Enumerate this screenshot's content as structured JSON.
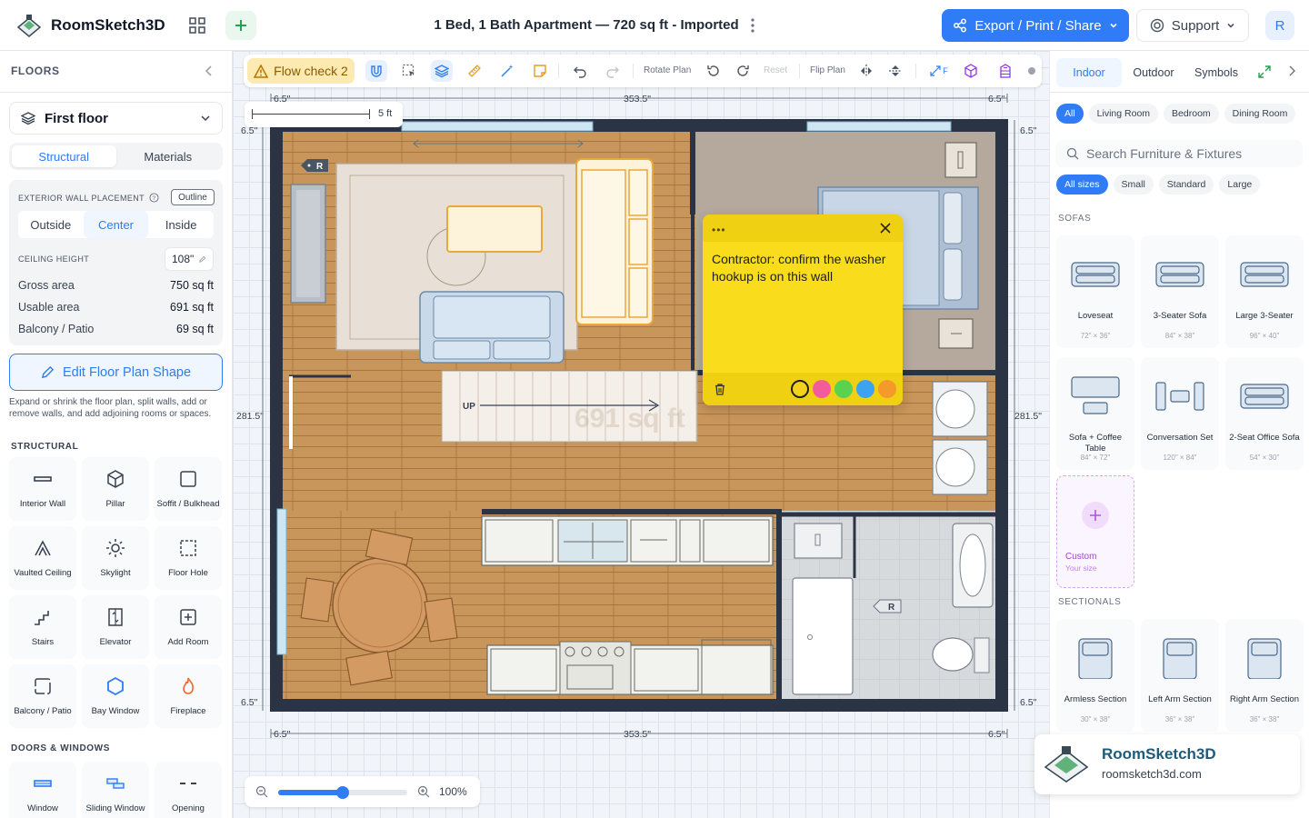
{
  "app": {
    "name": "RoomSketch3D",
    "document_title": "1 Bed, 1 Bath Apartment — 720 sq ft - Imported"
  },
  "header": {
    "export_label": "Export / Print / Share",
    "support_label": "Support",
    "avatar_initial": "R"
  },
  "sidebar": {
    "title": "FLOORS",
    "floor_selected": "First floor",
    "tabs": [
      "Structural",
      "Materials"
    ],
    "exterior_wall_placement": {
      "label": "EXTERIOR WALL PLACEMENT",
      "outline_label": "Outline",
      "options": [
        "Outside",
        "Center",
        "Inside"
      ],
      "selected": "Center"
    },
    "ceiling_height": {
      "label": "CEILING HEIGHT",
      "value": "108\""
    },
    "stats": [
      {
        "label": "Gross area",
        "value": "750 sq ft"
      },
      {
        "label": "Usable area",
        "value": "691 sq ft"
      },
      {
        "label": "Balcony / Patio",
        "value": "69 sq ft"
      }
    ],
    "edit_shape_label": "Edit Floor Plan Shape",
    "edit_shape_desc": "Expand or shrink the floor plan, split walls, add or remove walls, and add adjoining rooms or spaces.",
    "structural_title": "STRUCTURAL",
    "structural_items": [
      {
        "label": "Interior Wall",
        "icon": "interior-wall-icon"
      },
      {
        "label": "Pillar",
        "icon": "pillar-icon"
      },
      {
        "label": "Soffit / Bulkhead",
        "icon": "soffit-icon"
      },
      {
        "label": "Vaulted Ceiling",
        "icon": "vaulted-ceiling-icon"
      },
      {
        "label": "Skylight",
        "icon": "skylight-icon"
      },
      {
        "label": "Floor Hole",
        "icon": "floor-hole-icon"
      },
      {
        "label": "Stairs",
        "icon": "stairs-icon"
      },
      {
        "label": "Elevator",
        "icon": "elevator-icon"
      },
      {
        "label": "Add Room",
        "icon": "add-room-icon"
      },
      {
        "label": "Balcony / Patio",
        "icon": "balcony-icon"
      },
      {
        "label": "Bay Window",
        "icon": "bay-window-icon"
      },
      {
        "label": "Fireplace",
        "icon": "fireplace-icon"
      }
    ],
    "doors_title": "DOORS & WINDOWS",
    "doors_items": [
      {
        "label": "Window",
        "icon": "window-icon"
      },
      {
        "label": "Sliding Window",
        "icon": "sliding-window-icon"
      },
      {
        "label": "Opening",
        "icon": "opening-icon"
      }
    ]
  },
  "toolbar": {
    "flow_check_label": "Flow check 2",
    "rotate_label": "Rotate Plan",
    "reset_label": "Reset",
    "flip_label": "Flip Plan",
    "f_label": "F"
  },
  "plan": {
    "scale_label": "5 ft",
    "dims": {
      "top_left": "6.5\"",
      "top_mid": "353.5\"",
      "top_right": "6.5\"",
      "left_top": "6.5\"",
      "left_mid": "281.5\"",
      "left_bot": "6.5\"",
      "right_top": "6.5\"",
      "right_mid": "281.5\"",
      "right_bot": "6.5\"",
      "bot_left": "6.5\"",
      "bot_mid": "353.5\"",
      "bot_right": "6.5\""
    },
    "stairs_label": "UP",
    "area_watermark": "691 sq ft",
    "room_tag": "R"
  },
  "note": {
    "text": "Contractor: confirm the washer hookup is on this wall",
    "swatches": [
      "#f2d21b",
      "#f25c9b",
      "#5bd24f",
      "#3ba3f0",
      "#f39a2b"
    ]
  },
  "zoom": {
    "value": 0.5,
    "label": "100%"
  },
  "right_panel": {
    "tabs": [
      "Indoor",
      "Outdoor",
      "Symbols"
    ],
    "room_filters": [
      "All",
      "Living Room",
      "Bedroom",
      "Dining Room"
    ],
    "search_placeholder": "Search Furniture & Fixtures",
    "size_filters": [
      "All sizes",
      "Small",
      "Standard",
      "Large"
    ],
    "sofas_title": "SOFAS",
    "sofas": [
      {
        "name": "Loveseat",
        "dim": "72\" × 36\""
      },
      {
        "name": "3-Seater Sofa",
        "dim": "84\" × 38\""
      },
      {
        "name": "Large 3-Seater",
        "dim": "96\" × 40\""
      },
      {
        "name": "Sofa + Coffee Table",
        "dim": "84\" × 72\""
      },
      {
        "name": "Conversation Set",
        "dim": "120\" × 84\""
      },
      {
        "name": "2-Seat Office Sofa",
        "dim": "54\" × 30\""
      }
    ],
    "custom": {
      "name": "Custom",
      "sub": "Your size"
    },
    "sectionals_title": "SECTIONALS",
    "sectionals": [
      {
        "name": "Armless Section",
        "dim": "30\" × 38\""
      },
      {
        "name": "Left Arm Section",
        "dim": "36\" × 38\""
      },
      {
        "name": "Right Arm Section",
        "dim": "36\" × 38\""
      }
    ]
  },
  "watermark": {
    "name": "RoomSketch3D",
    "url": "roomsketch3d.com"
  },
  "colors": {
    "accent": "#2f7cf6",
    "wall": "#2b3445",
    "wood": "#c8955a",
    "note": "#f9dc1c"
  }
}
